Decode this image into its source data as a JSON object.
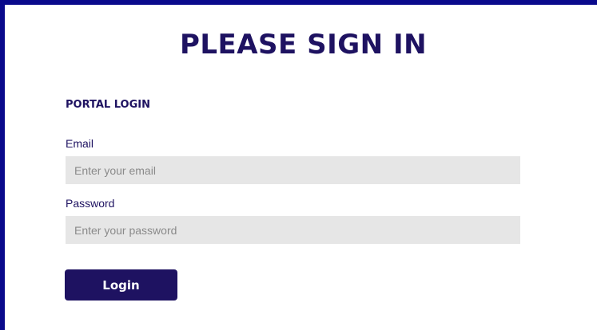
{
  "page": {
    "title": "PLEASE SIGN IN"
  },
  "form": {
    "heading": "PORTAL LOGIN",
    "email": {
      "label": "Email",
      "value": "",
      "placeholder": "Enter your email"
    },
    "password": {
      "label": "Password",
      "value": "",
      "placeholder": "Enter your password"
    },
    "submit_label": "Login"
  },
  "colors": {
    "brand": "#1e1261",
    "frame_border": "#0a0a8c",
    "input_background": "#e6e6e6"
  }
}
